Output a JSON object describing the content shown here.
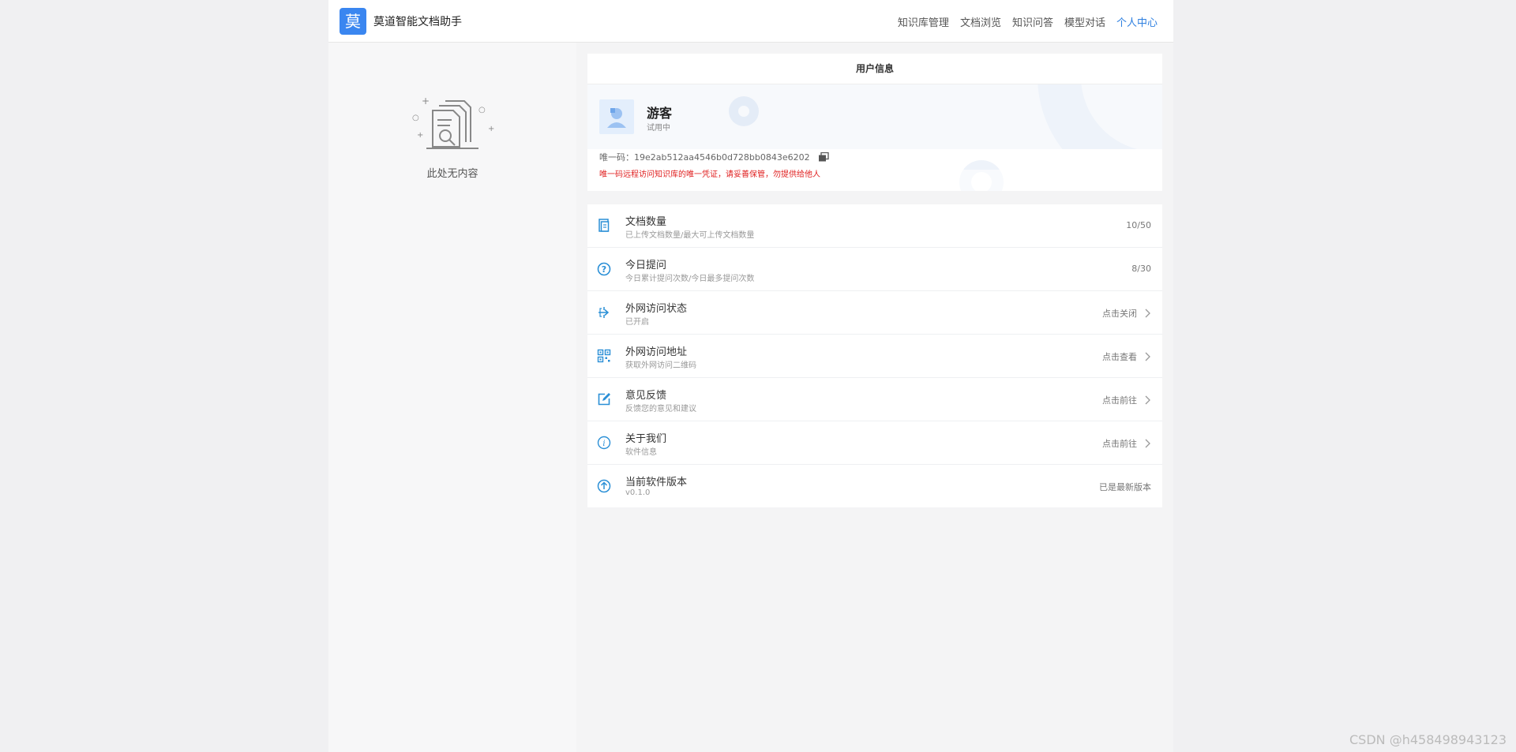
{
  "header": {
    "logo_char": "莫",
    "title": "莫道智能文档助手",
    "nav": [
      {
        "label": "知识库管理",
        "active": false
      },
      {
        "label": "文档浏览",
        "active": false
      },
      {
        "label": "知识问答",
        "active": false
      },
      {
        "label": "模型对话",
        "active": false
      },
      {
        "label": "个人中心",
        "active": true
      }
    ]
  },
  "left": {
    "empty_text": "此处无内容"
  },
  "user_card": {
    "title": "用户信息",
    "username": "游客",
    "status": "试用中",
    "uid_label": "唯一码：",
    "uid_value": "19e2ab512aa4546b0d728bb0843e6202",
    "warning": "唯一码远程访问知识库的唯一凭证，请妥善保管，勿提供给他人"
  },
  "items": [
    {
      "icon": "document-icon",
      "title": "文档数量",
      "sub": "已上传文档数量/最大可上传文档数量",
      "right": "10/50",
      "chevron": false
    },
    {
      "icon": "question-icon",
      "title": "今日提问",
      "sub": "今日累计提问次数/今日最多提问次数",
      "right": "8/30",
      "chevron": false
    },
    {
      "icon": "external-access-icon",
      "title": "外网访问状态",
      "sub": "已开启",
      "right": "点击关闭",
      "chevron": true
    },
    {
      "icon": "qrcode-icon",
      "title": "外网访问地址",
      "sub": "获取外网访问二维码",
      "right": "点击查看",
      "chevron": true
    },
    {
      "icon": "edit-icon",
      "title": "意见反馈",
      "sub": "反馈您的意见和建议",
      "right": "点击前往",
      "chevron": true
    },
    {
      "icon": "info-icon",
      "title": "关于我们",
      "sub": "软件信息",
      "right": "点击前往",
      "chevron": true
    },
    {
      "icon": "upload-icon",
      "title": "当前软件版本",
      "sub": "v0.1.0",
      "right": "已是最新版本",
      "chevron": false
    }
  ],
  "watermark": "CSDN @h458498943123",
  "colors": {
    "accent": "#2d7fe0",
    "logo": "#3a86f0",
    "icon": "#2a8fd6",
    "warning": "#e02020"
  }
}
